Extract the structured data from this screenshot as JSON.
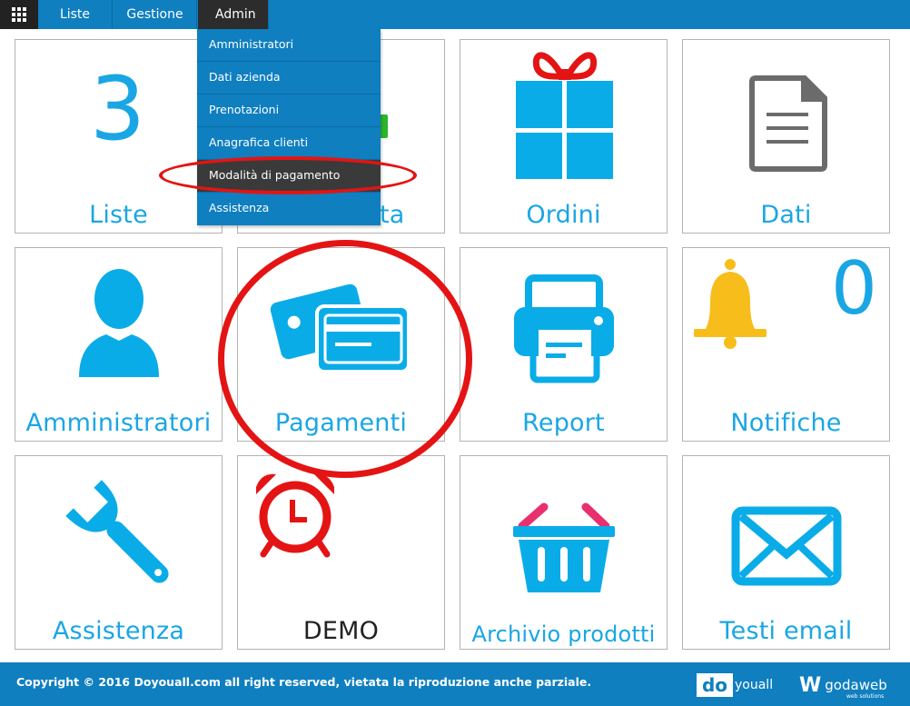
{
  "nav": {
    "items": [
      "Liste",
      "Gestione",
      "Admin"
    ]
  },
  "admin_menu": {
    "items": [
      "Amministratori",
      "Dati azienda",
      "Prenotazioni",
      "Anagrafica clienti",
      "Modalità di pagamento",
      "Assistenza"
    ],
    "highlighted": "Modalità di pagamento"
  },
  "tiles": {
    "liste": {
      "label": "Liste",
      "count": "3"
    },
    "tile2": {
      "label_visible_fragment": "ta"
    },
    "ordini": {
      "label": "Ordini"
    },
    "dati": {
      "label": "Dati"
    },
    "amministratori": {
      "label": "Amministratori"
    },
    "pagamenti": {
      "label": "Pagamenti"
    },
    "report": {
      "label": "Report"
    },
    "notifiche": {
      "label": "Notifiche",
      "count": "0"
    },
    "assistenza": {
      "label": "Assistenza"
    },
    "demo": {
      "label": "DEMO"
    },
    "archivio": {
      "label": "Archivio prodotti"
    },
    "testi_email": {
      "label": "Testi email"
    }
  },
  "icons": {
    "liste": "number-3",
    "ordini": "gift-icon",
    "dati": "document-icon",
    "amministratori": "user-icon",
    "pagamenti": "credit-cards-icon",
    "report": "printer-icon",
    "notifiche": "bell-icon",
    "assistenza": "wrench-icon",
    "demo": "alarm-clock-icon",
    "archivio": "basket-icon",
    "testi_email": "envelope-icon"
  },
  "footer": {
    "copyright": "Copyright © 2016 Doyouall.com all right reserved, vietata la riproduzione anche parziale.",
    "logo1_box": "do",
    "logo1_text": "youall",
    "logo2_mark": "W",
    "logo2_text": "godaweb",
    "logo2_sub": "web solutions"
  },
  "colors": {
    "primary_blue": "#0f7fc0",
    "tile_blue": "#1aa6e4",
    "annotation_red": "#e41414",
    "bell_yellow": "#f7bd1a",
    "gift_bow_red": "#e41414"
  }
}
